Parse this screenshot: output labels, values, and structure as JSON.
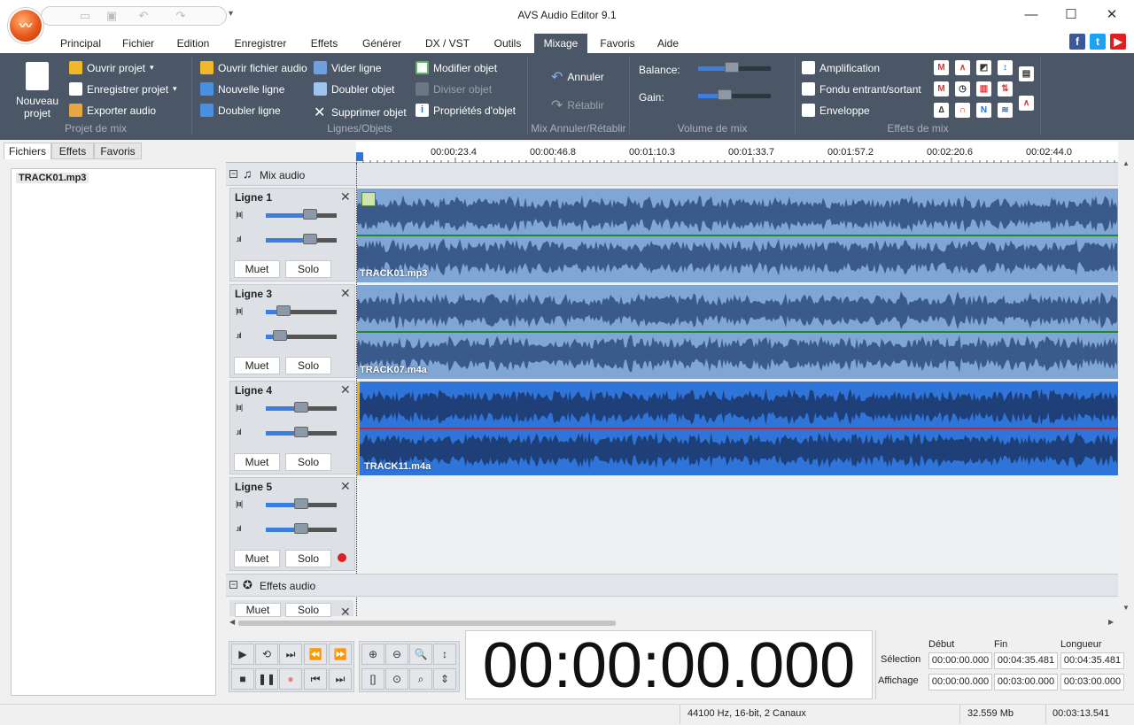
{
  "app": {
    "title": "AVS Audio Editor 9.1",
    "logo_icon": "avs-logo-icon"
  },
  "menu": {
    "tabs": [
      "Principal",
      "Fichier",
      "Edition",
      "Enregistrer",
      "Effets",
      "Générer",
      "DX / VST",
      "Outils",
      "Mixage",
      "Favoris",
      "Aide"
    ],
    "active": "Mixage"
  },
  "social": [
    "f",
    "t",
    "▶"
  ],
  "ribbon": {
    "projet": {
      "nouveau": "Nouveau projet",
      "ouvrir": "Ouvrir projet",
      "enregistrer": "Enregistrer projet",
      "exporter": "Exporter audio",
      "group": "Projet de mix"
    },
    "lignes": {
      "ouvrir_fichier": "Ouvrir fichier audio",
      "nouvelle_ligne": "Nouvelle ligne",
      "doubler_ligne": "Doubler ligne",
      "vider_ligne": "Vider ligne",
      "doubler_objet": "Doubler objet",
      "supprimer_objet": "Supprimer objet",
      "modifier_objet": "Modifier objet",
      "diviser_objet": "Diviser objet",
      "proprietes": "Propriétés d'objet",
      "group": "Lignes/Objets"
    },
    "annuler": {
      "annuler": "Annuler",
      "retablir": "Rétablir",
      "group": "Mix Annuler/Rétablir"
    },
    "volume": {
      "balance": "Balance:",
      "gain": "Gain:",
      "group": "Volume de mix"
    },
    "effets": {
      "amplification": "Amplification",
      "fondu": "Fondu entrant/sortant",
      "enveloppe": "Enveloppe",
      "group": "Effets de mix"
    }
  },
  "left": {
    "tabs": [
      "Fichiers",
      "Effets",
      "Favoris"
    ],
    "files": [
      "TRACK01.mp3"
    ]
  },
  "ruler": {
    "ticks": [
      "00:00:23.4",
      "00:00:46.8",
      "00:01:10.3",
      "00:01:33.7",
      "00:01:57.2",
      "00:02:20.6",
      "00:02:44.0"
    ]
  },
  "mix": {
    "title": "Mix audio",
    "effects_title": "Effets audio"
  },
  "lines": [
    {
      "name": "Ligne 1",
      "clip": "TRACK01.mp3",
      "balance": 0.62,
      "gain": 0.62
    },
    {
      "name": "Ligne 3",
      "clip": "TRACK07.m4a",
      "balance": 0.25,
      "gain": 0.2
    },
    {
      "name": "Ligne 4",
      "clip": "TRACK11.m4a",
      "balance": 0.5,
      "gain": 0.5
    },
    {
      "name": "Ligne 5",
      "clip": "",
      "balance": 0.5,
      "gain": 0.5
    }
  ],
  "buttons": {
    "muet": "Muet",
    "solo": "Solo"
  },
  "time": {
    "display": "00:00:00.000"
  },
  "selection": {
    "debut_h": "Début",
    "fin_h": "Fin",
    "longueur_h": "Longueur",
    "selection_l": "Sélection",
    "affichage_l": "Affichage",
    "sel": [
      "00:00:00.000",
      "00:04:35.481",
      "00:04:35.481"
    ],
    "aff": [
      "00:00:00.000",
      "00:03:00.000",
      "00:03:00.000"
    ]
  },
  "status": {
    "format": "44100 Hz, 16-bit, 2 Canaux",
    "size": "32.559 Mb",
    "duration": "00:03:13.541"
  }
}
